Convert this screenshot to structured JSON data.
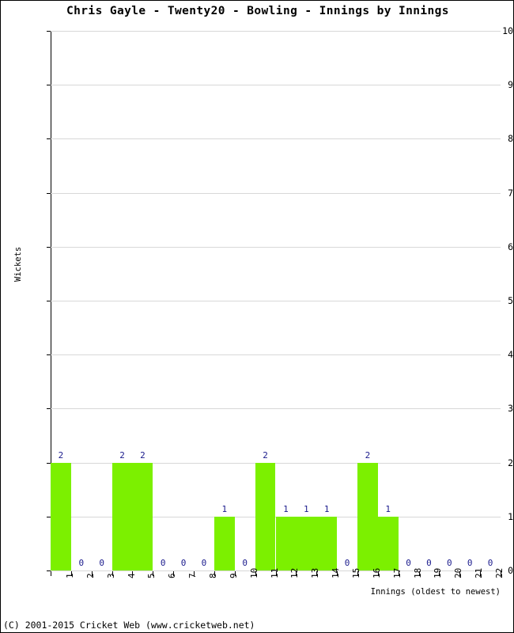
{
  "chart_data": {
    "type": "bar",
    "title": "Chris Gayle - Twenty20 - Bowling - Innings by Innings",
    "xlabel": "Innings (oldest to newest)",
    "ylabel": "Wickets",
    "categories": [
      "1",
      "2",
      "3",
      "4",
      "5",
      "6",
      "7",
      "8",
      "9",
      "10",
      "11",
      "12",
      "13",
      "14",
      "15",
      "16",
      "17",
      "18",
      "19",
      "20",
      "21",
      "22"
    ],
    "values": [
      2,
      0,
      0,
      2,
      2,
      0,
      0,
      0,
      1,
      0,
      2,
      1,
      1,
      1,
      0,
      2,
      1,
      0,
      0,
      0,
      0,
      0
    ],
    "data_labels": [
      "2",
      "0",
      "0",
      "2",
      "2",
      "0",
      "0",
      "0",
      "1",
      "0",
      "2",
      "1",
      "1",
      "1",
      "0",
      "2",
      "1",
      "0",
      "0",
      "0",
      "0",
      "0"
    ],
    "ylim": [
      0,
      10
    ],
    "y_ticks": [
      "0",
      "1",
      "2",
      "3",
      "4",
      "5",
      "6",
      "7",
      "8",
      "9",
      "10"
    ],
    "grid": true,
    "legend": "none",
    "bar_color": "#7CF000",
    "label_color": "#1a1a8c",
    "gridline_color": "#d8d8d8",
    "axis_color": "#000000",
    "background": "#ffffff"
  },
  "footer": {
    "copyright": "(C) 2001-2015 Cricket Web (www.cricketweb.net)"
  }
}
